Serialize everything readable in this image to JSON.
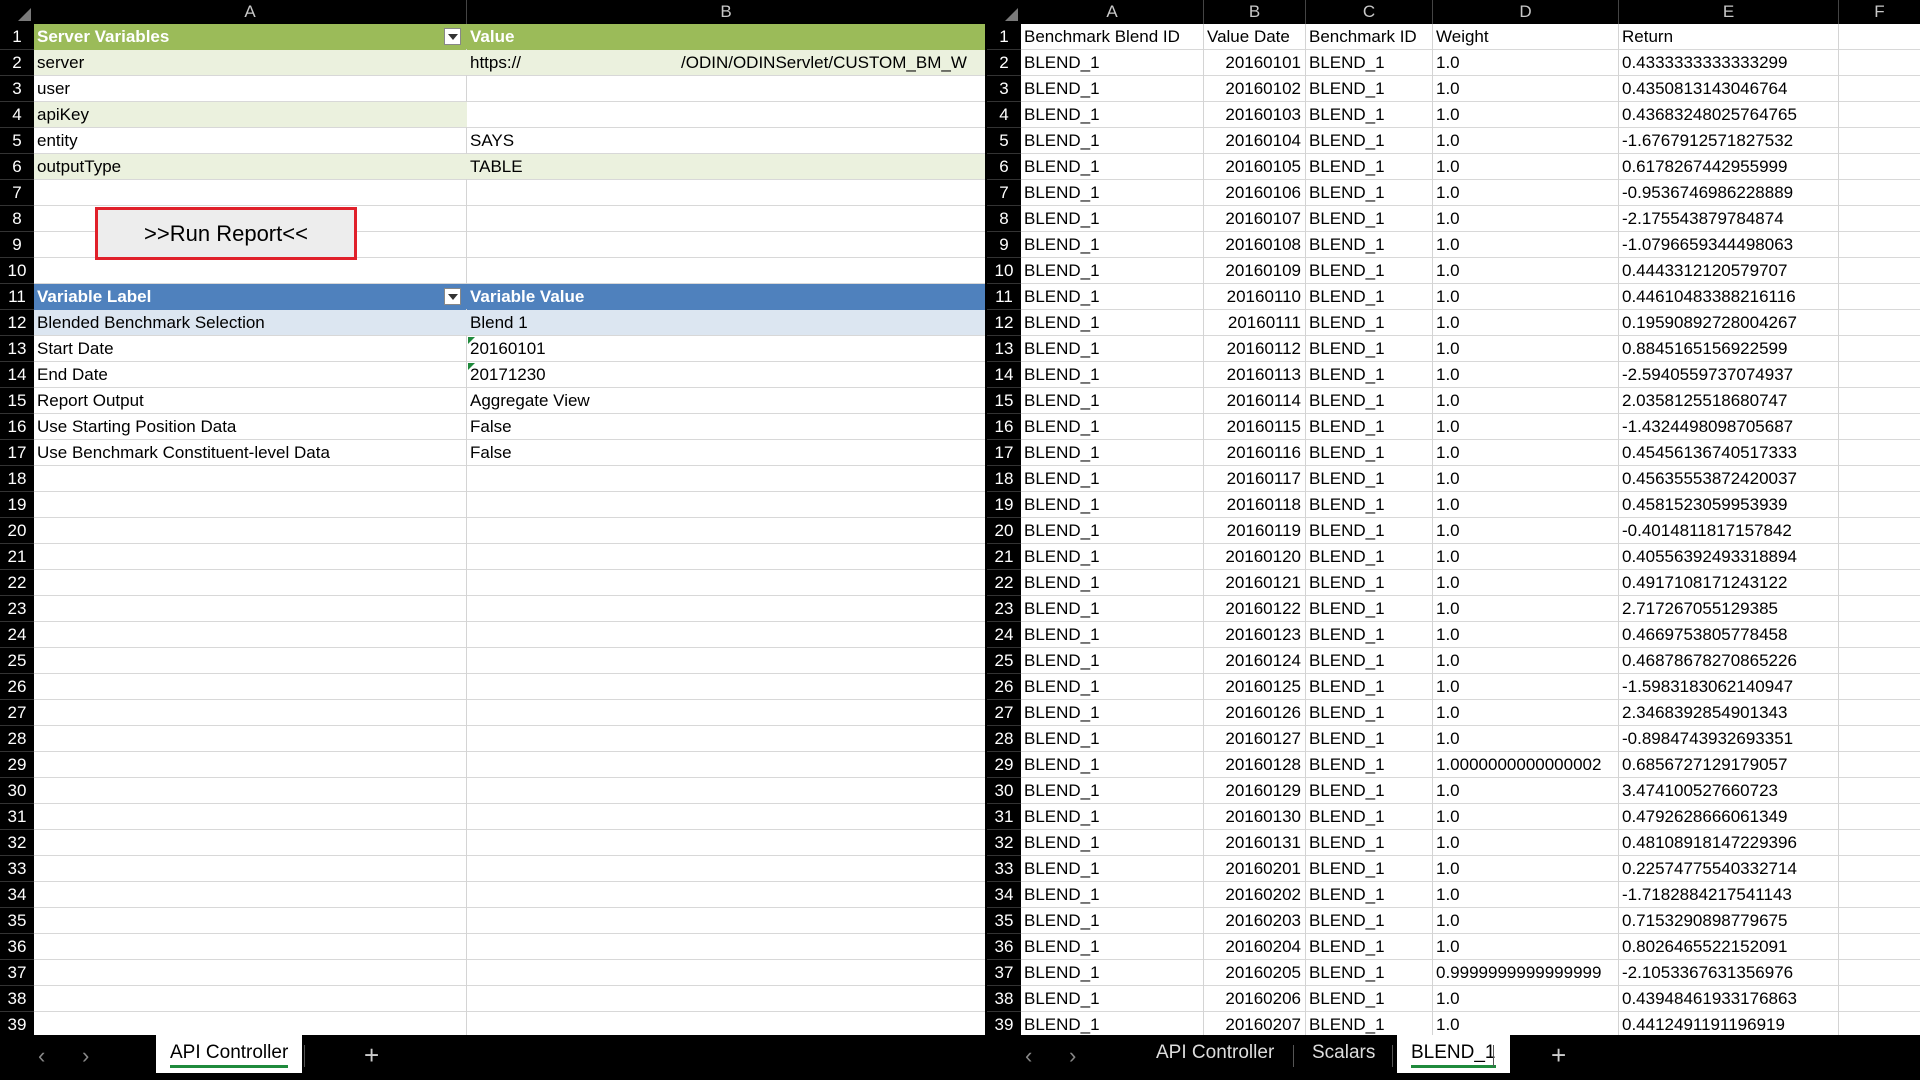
{
  "left": {
    "columns": [
      "A",
      "B"
    ],
    "row_numbers": [
      "1",
      "2",
      "3",
      "4",
      "5",
      "6",
      "7",
      "8",
      "9",
      "10",
      "11",
      "12",
      "13",
      "14",
      "15",
      "16",
      "17",
      "18",
      "19",
      "20",
      "21",
      "22",
      "23",
      "24",
      "25",
      "26",
      "27",
      "28",
      "29",
      "30",
      "31",
      "32",
      "33",
      "34",
      "35",
      "36",
      "37",
      "38",
      "39"
    ],
    "server_header": {
      "label": "Server Variables",
      "value": "Value"
    },
    "server_vars": [
      {
        "label": "server",
        "value_a": "https://",
        "value_b": "/ODIN/ODINServlet/CUSTOM_BM_W"
      },
      {
        "label": "user",
        "value_a": "",
        "value_b": ""
      },
      {
        "label": "apiKey",
        "value_a": "",
        "value_b": ""
      },
      {
        "label": "entity",
        "value_a": "SAYS",
        "value_b": ""
      },
      {
        "label": "outputType",
        "value_a": "TABLE",
        "value_b": ""
      }
    ],
    "run_button": ">>Run Report<<",
    "variable_header": {
      "label": "Variable Label",
      "value": "Variable Value"
    },
    "variables": [
      {
        "label": "Blended Benchmark Selection",
        "value": "Blend 1"
      },
      {
        "label": "Start Date",
        "value": "20160101"
      },
      {
        "label": "End Date",
        "value": "20171230"
      },
      {
        "label": "Report Output",
        "value": "Aggregate View"
      },
      {
        "label": "Use Starting Position Data",
        "value": "False"
      },
      {
        "label": "Use Benchmark Constituent-level Data",
        "value": "False"
      }
    ],
    "tabs": [
      "API Controller"
    ],
    "add_label": "+"
  },
  "right": {
    "columns": [
      "A",
      "B",
      "C",
      "D",
      "E",
      "F"
    ],
    "row_numbers": [
      "1",
      "2",
      "3",
      "4",
      "5",
      "6",
      "7",
      "8",
      "9",
      "10",
      "11",
      "12",
      "13",
      "14",
      "15",
      "16",
      "17",
      "18",
      "19",
      "20",
      "21",
      "22",
      "23",
      "24",
      "25",
      "26",
      "27",
      "28",
      "29",
      "30",
      "31",
      "32",
      "33",
      "34",
      "35",
      "36",
      "37",
      "38",
      "39"
    ],
    "headers": [
      "Benchmark Blend ID",
      "Value Date",
      "Benchmark ID",
      "Weight",
      "Return"
    ],
    "rows": [
      [
        "BLEND_1",
        "20160101",
        "BLEND_1",
        "1.0",
        "0.4333333333333299"
      ],
      [
        "BLEND_1",
        "20160102",
        "BLEND_1",
        "1.0",
        "0.4350813143046764"
      ],
      [
        "BLEND_1",
        "20160103",
        "BLEND_1",
        "1.0",
        "0.43683248025764765"
      ],
      [
        "BLEND_1",
        "20160104",
        "BLEND_1",
        "1.0",
        "-1.6767912571827532"
      ],
      [
        "BLEND_1",
        "20160105",
        "BLEND_1",
        "1.0",
        "0.6178267442955999"
      ],
      [
        "BLEND_1",
        "20160106",
        "BLEND_1",
        "1.0",
        "-0.9536746986228889"
      ],
      [
        "BLEND_1",
        "20160107",
        "BLEND_1",
        "1.0",
        "-2.175543879784874"
      ],
      [
        "BLEND_1",
        "20160108",
        "BLEND_1",
        "1.0",
        "-1.0796659344498063"
      ],
      [
        "BLEND_1",
        "20160109",
        "BLEND_1",
        "1.0",
        "0.4443312120579707"
      ],
      [
        "BLEND_1",
        "20160110",
        "BLEND_1",
        "1.0",
        "0.44610483388216116"
      ],
      [
        "BLEND_1",
        "20160111",
        "BLEND_1",
        "1.0",
        "0.19590892728004267"
      ],
      [
        "BLEND_1",
        "20160112",
        "BLEND_1",
        "1.0",
        "0.8845165156922599"
      ],
      [
        "BLEND_1",
        "20160113",
        "BLEND_1",
        "1.0",
        "-2.5940559737074937"
      ],
      [
        "BLEND_1",
        "20160114",
        "BLEND_1",
        "1.0",
        "2.0358125518680747"
      ],
      [
        "BLEND_1",
        "20160115",
        "BLEND_1",
        "1.0",
        "-1.4324498098705687"
      ],
      [
        "BLEND_1",
        "20160116",
        "BLEND_1",
        "1.0",
        "0.45456136740517333"
      ],
      [
        "BLEND_1",
        "20160117",
        "BLEND_1",
        "1.0",
        "0.45635553872420037"
      ],
      [
        "BLEND_1",
        "20160118",
        "BLEND_1",
        "1.0",
        "0.4581523059953939"
      ],
      [
        "BLEND_1",
        "20160119",
        "BLEND_1",
        "1.0",
        "-0.4014811817157842"
      ],
      [
        "BLEND_1",
        "20160120",
        "BLEND_1",
        "1.0",
        "0.40556392493318894"
      ],
      [
        "BLEND_1",
        "20160121",
        "BLEND_1",
        "1.0",
        "0.4917108171243122"
      ],
      [
        "BLEND_1",
        "20160122",
        "BLEND_1",
        "1.0",
        "2.717267055129385"
      ],
      [
        "BLEND_1",
        "20160123",
        "BLEND_1",
        "1.0",
        "0.4669753805778458"
      ],
      [
        "BLEND_1",
        "20160124",
        "BLEND_1",
        "1.0",
        "0.46878678270865226"
      ],
      [
        "BLEND_1",
        "20160125",
        "BLEND_1",
        "1.0",
        "-1.5983183062140947"
      ],
      [
        "BLEND_1",
        "20160126",
        "BLEND_1",
        "1.0",
        "2.3468392854901343"
      ],
      [
        "BLEND_1",
        "20160127",
        "BLEND_1",
        "1.0",
        "-0.8984743932693351"
      ],
      [
        "BLEND_1",
        "20160128",
        "BLEND_1",
        "1.0000000000000002",
        "0.6856727129179057"
      ],
      [
        "BLEND_1",
        "20160129",
        "BLEND_1",
        "1.0",
        "3.474100527660723"
      ],
      [
        "BLEND_1",
        "20160130",
        "BLEND_1",
        "1.0",
        "0.4792628666061349"
      ],
      [
        "BLEND_1",
        "20160131",
        "BLEND_1",
        "1.0",
        "0.48108918147229396"
      ],
      [
        "BLEND_1",
        "20160201",
        "BLEND_1",
        "1.0",
        "0.22574775540332714"
      ],
      [
        "BLEND_1",
        "20160202",
        "BLEND_1",
        "1.0",
        "-1.7182884217541143"
      ],
      [
        "BLEND_1",
        "20160203",
        "BLEND_1",
        "1.0",
        "0.7153290898779675"
      ],
      [
        "BLEND_1",
        "20160204",
        "BLEND_1",
        "1.0",
        "0.8026465522152091"
      ],
      [
        "BLEND_1",
        "20160205",
        "BLEND_1",
        "0.9999999999999999",
        "-2.1053367631356976"
      ],
      [
        "BLEND_1",
        "20160206",
        "BLEND_1",
        "1.0",
        "0.43948461933176863"
      ],
      [
        "BLEND_1",
        "20160207",
        "BLEND_1",
        "1.0",
        "0.4412491191196919"
      ]
    ],
    "tabs": [
      "API Controller",
      "Scalars",
      "BLEND_1"
    ],
    "active_tab": "BLEND_1",
    "add_label": "+"
  },
  "nav": {
    "prev": "‹",
    "next": "›"
  }
}
